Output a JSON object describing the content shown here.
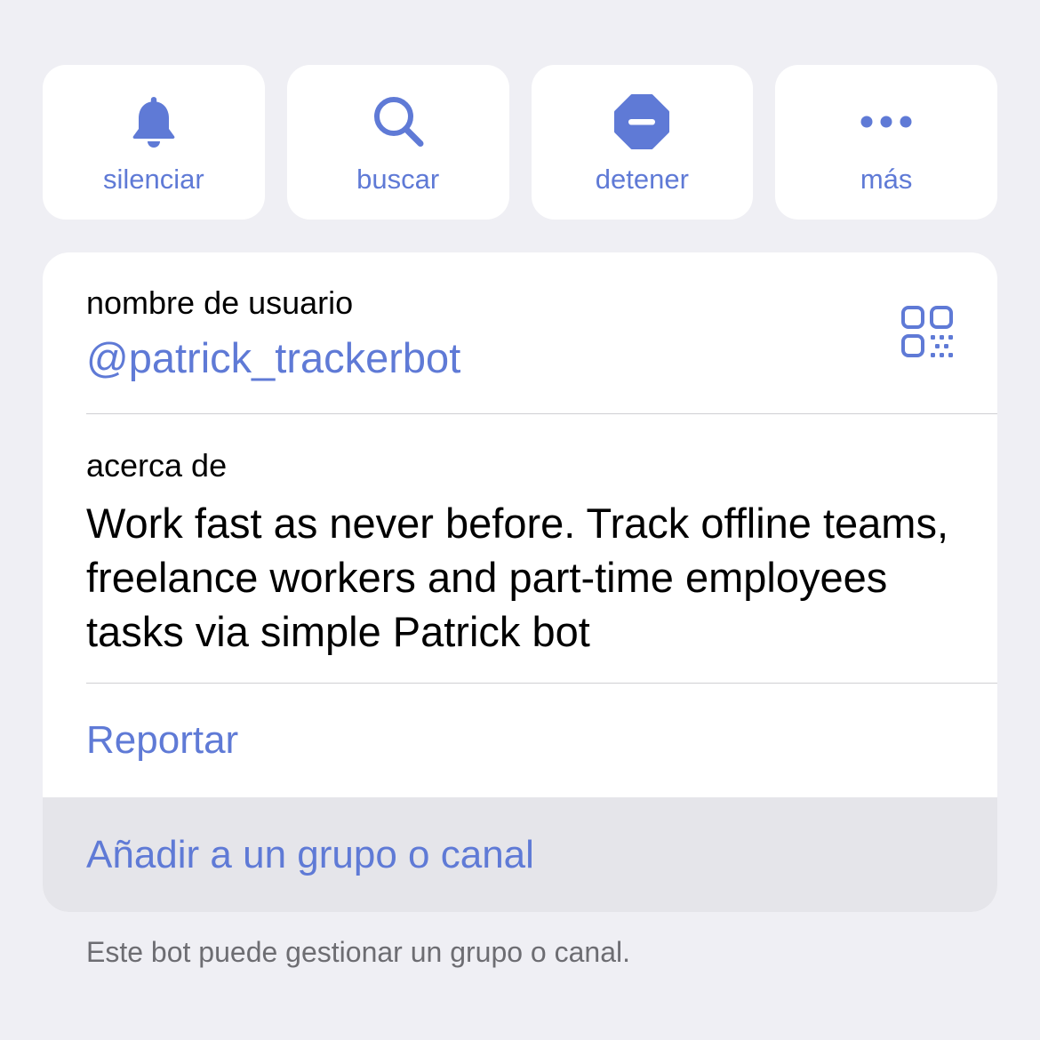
{
  "accent_color": "#5f7ad6",
  "actions": [
    {
      "label": "silenciar",
      "icon": "bell-icon"
    },
    {
      "label": "buscar",
      "icon": "search-icon"
    },
    {
      "label": "detener",
      "icon": "stop-icon"
    },
    {
      "label": "más",
      "icon": "more-icon"
    }
  ],
  "profile": {
    "username_label": "nombre de usuario",
    "username": "@patrick_trackerbot",
    "qr_icon": "qr-code-icon",
    "about_label": "acerca de",
    "about_text": "Work fast as never before. Track offline teams, freelance workers and part-time employees tasks via simple Patrick bot",
    "report_label": "Reportar",
    "add_label": "Añadir a un grupo o canal"
  },
  "footer_note": "Este bot puede gestionar un grupo o canal."
}
